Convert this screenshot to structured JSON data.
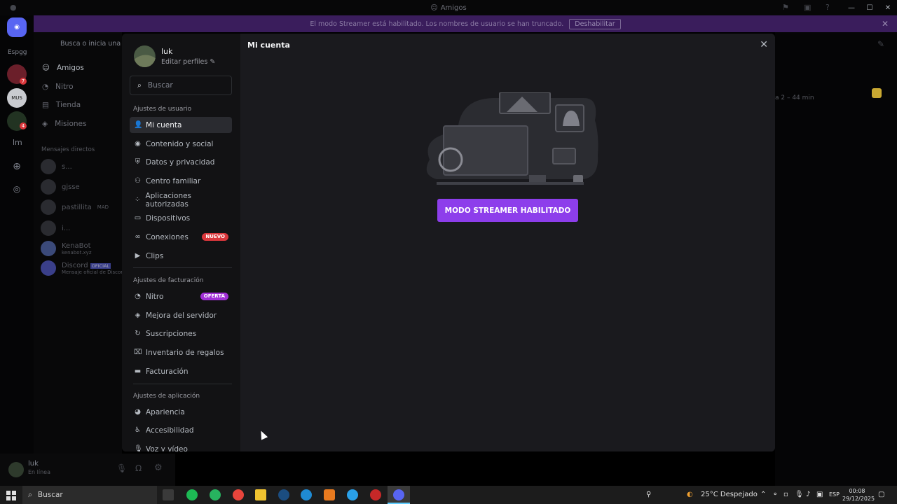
{
  "window": {
    "title": "Amigos"
  },
  "banner": {
    "text": "El modo Streamer está habilitado. Los nombres de usuario se han truncado.",
    "button": "Deshabilitar"
  },
  "servers": {
    "label_top": "Espgg",
    "badge1": "7",
    "badge2": "4",
    "label_lm": "lm"
  },
  "dm": {
    "search": "Busca o inicia una con",
    "nav": [
      "Amigos",
      "Nitro",
      "Tienda",
      "Misiones"
    ],
    "section": "Mensajes directos",
    "items": [
      {
        "name": "s..."
      },
      {
        "name": "gjsse"
      },
      {
        "name": "pastillita",
        "tag": "MAD"
      },
      {
        "name": "i..."
      },
      {
        "name": "KenaBot",
        "sub": "kenabot.xyz"
      },
      {
        "name": "Discord",
        "tag": "OFICIAL",
        "sub": "Mensaje oficial de Discord"
      }
    ]
  },
  "right": {
    "time_label": "a 2 – 44 min"
  },
  "userbar": {
    "name": "luk",
    "status": "En línea"
  },
  "settings": {
    "profile": {
      "name": "luk",
      "edit": "Editar perfiles"
    },
    "search_placeholder": "Buscar",
    "sections": {
      "user": "Ajustes de usuario",
      "billing": "Ajustes de facturación",
      "app": "Ajustes de aplicación"
    },
    "user_items": [
      "Mi cuenta",
      "Contenido y social",
      "Datos y privacidad",
      "Centro familiar",
      "Aplicaciones autorizadas",
      "Dispositivos",
      "Conexiones",
      "Clips"
    ],
    "billing_items": [
      "Nitro",
      "Mejora del servidor",
      "Suscripciones",
      "Inventario de regalos",
      "Facturación"
    ],
    "app_items": [
      "Apariencia",
      "Accesibilidad",
      "Voz y vídeo"
    ],
    "badges": {
      "nuevo": "NUEVO",
      "oferta": "OFERTA"
    },
    "content_title": "Mi cuenta",
    "streamer_button": "MODO STREAMER HABILITADO"
  },
  "taskbar": {
    "search": "Buscar",
    "weather": "25°C  Despejado",
    "lang": "ESP",
    "time": "00:08",
    "date": "29/12/2025"
  },
  "colors": {
    "accent": "#8d3eeb",
    "nuevo": "#da373c",
    "oferta": "#a12fd6"
  }
}
